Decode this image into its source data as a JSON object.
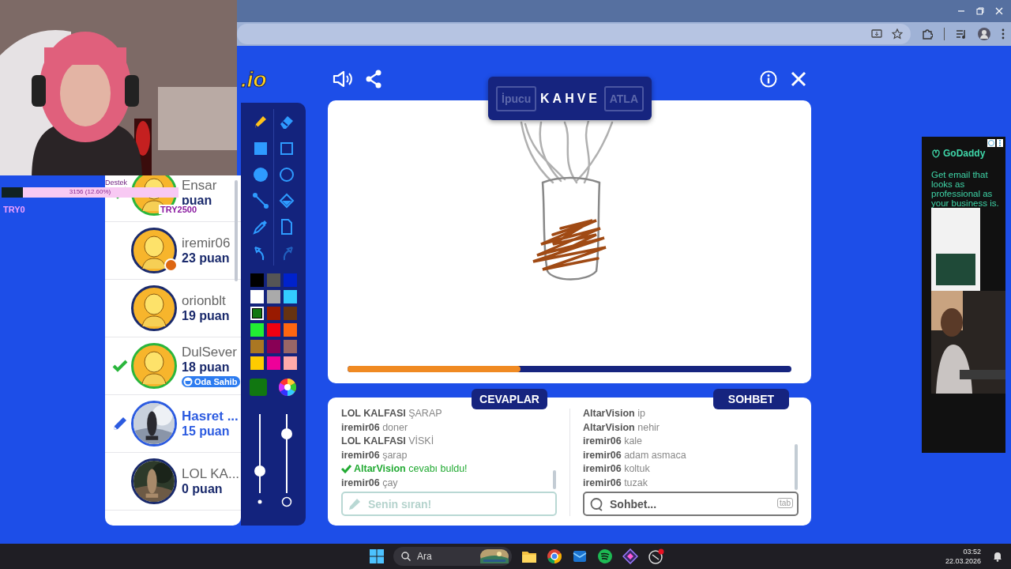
{
  "stream_overlay": {
    "goal_label": "Destek",
    "goal_progress": "3156 (12.60%)",
    "level": 0.12,
    "min": "TRY0",
    "max": "TRY2500"
  },
  "game": {
    "logo": ".io",
    "players": [
      {
        "name": "Ensar",
        "score": "puan",
        "guessed": true,
        "drawing": false,
        "kind": "default",
        "away": false
      },
      {
        "name": "iremir06",
        "score": "23 puan",
        "guessed": false,
        "drawing": false,
        "kind": "default",
        "away": true
      },
      {
        "name": "orionblt",
        "score": "19 puan",
        "guessed": false,
        "drawing": false,
        "kind": "default",
        "away": false
      },
      {
        "name": "DulSever",
        "score": "18 puan",
        "guessed": true,
        "drawing": false,
        "kind": "default",
        "away": false,
        "badge": "Oda Sahib"
      },
      {
        "name": "Hasret ...",
        "score": "15 puan",
        "guessed": false,
        "drawing": true,
        "kind": "picture",
        "away": false
      },
      {
        "name": "LOL KA...",
        "score": "0 puan",
        "guessed": false,
        "drawing": false,
        "kind": "picture",
        "away": false
      }
    ],
    "tools": [
      {
        "kind": "pencil",
        "selected": true,
        "disabled": false
      },
      {
        "kind": "eraser",
        "selected": false,
        "disabled": false
      },
      {
        "kind": "rect-fill",
        "selected": false,
        "disabled": false
      },
      {
        "kind": "rect",
        "selected": false,
        "disabled": false
      },
      {
        "kind": "circle-fill",
        "selected": false,
        "disabled": false
      },
      {
        "kind": "circle",
        "selected": false,
        "disabled": false
      },
      {
        "kind": "line",
        "selected": false,
        "disabled": false
      },
      {
        "kind": "bucket",
        "selected": false,
        "disabled": false
      },
      {
        "kind": "picker",
        "selected": false,
        "disabled": false
      },
      {
        "kind": "page",
        "selected": false,
        "disabled": false
      },
      {
        "kind": "undo",
        "selected": false,
        "disabled": false
      },
      {
        "kind": "redo",
        "selected": false,
        "disabled": true
      }
    ],
    "palette": [
      {
        "color": "#000000",
        "selected": false
      },
      {
        "color": "#555555",
        "selected": false
      },
      {
        "color": "#0022cc",
        "selected": false
      },
      {
        "color": "#ffffff",
        "selected": false
      },
      {
        "color": "#aaaaaa",
        "selected": false
      },
      {
        "color": "#33ccff",
        "selected": false
      },
      {
        "color": "#117711",
        "selected": true
      },
      {
        "color": "#991a00",
        "selected": false
      },
      {
        "color": "#663311",
        "selected": false
      },
      {
        "color": "#22ee33",
        "selected": false
      },
      {
        "color": "#ee0011",
        "selected": false
      },
      {
        "color": "#ff6611",
        "selected": false
      },
      {
        "color": "#aa7722",
        "selected": false
      },
      {
        "color": "#880055",
        "selected": false
      },
      {
        "color": "#996666",
        "selected": false
      },
      {
        "color": "#ffcc00",
        "selected": false
      },
      {
        "color": "#ee0099",
        "selected": false
      },
      {
        "color": "#ffaaaa",
        "selected": false
      }
    ],
    "sliders": [
      {
        "level": 0.24
      },
      {
        "level": 0.79
      }
    ],
    "word_panel": {
      "hint": {
        "label": "İpucu",
        "disabled": true
      },
      "word": "KAHVE",
      "skip": {
        "label": "ATLA",
        "disabled": true
      }
    },
    "canvas": {
      "timer": {
        "level": 0.39
      }
    },
    "answers": {
      "tab": "CEVAPLAR",
      "messages": [
        {
          "kind": "guess",
          "user": "LOL KALFASI",
          "text": "ŞARAP"
        },
        {
          "kind": "guess",
          "user": "iremir06",
          "text": "doner"
        },
        {
          "kind": "guess",
          "user": "LOL KALFASI",
          "text": "VİSKİ"
        },
        {
          "kind": "guess",
          "user": "iremir06",
          "text": "şarap"
        },
        {
          "kind": "correct",
          "user": "AltarVision",
          "text": "cevabı buldu!"
        },
        {
          "kind": "guess",
          "user": "iremir06",
          "text": "çay"
        }
      ],
      "placeholder": "Senin sıran!",
      "disabled": true
    },
    "chat": {
      "tab": "SOHBET",
      "messages": [
        {
          "user": "AltarVision",
          "text": "ip"
        },
        {
          "user": "AltarVision",
          "text": "nehir"
        },
        {
          "user": "iremir06",
          "text": "kale"
        },
        {
          "user": "iremir06",
          "text": "adam asmaca"
        },
        {
          "user": "iremir06",
          "text": "koltuk"
        },
        {
          "user": "iremir06",
          "text": "tuzak"
        }
      ],
      "placeholder": "Sohbet...",
      "shortcut": "tab"
    }
  },
  "ad": {
    "brand": "GoDaddy",
    "headline": "Get email that looks as professional as your business is."
  },
  "taskbar": {
    "search_placeholder": "Ara",
    "time": "03:52",
    "date": "22.03.2026"
  }
}
